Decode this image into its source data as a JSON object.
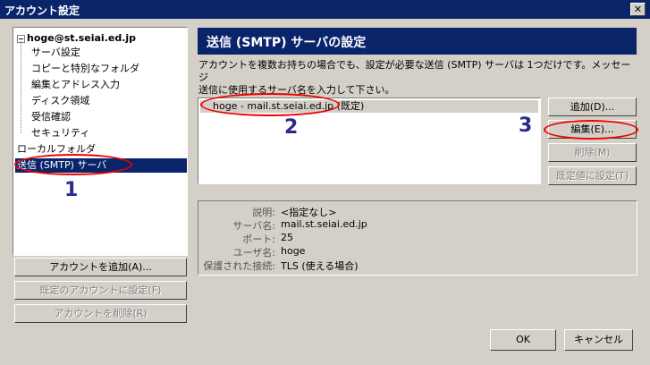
{
  "window": {
    "title": "アカウント設定",
    "close": "✕"
  },
  "tree": {
    "account": "hoge@st.seiai.ed.jp",
    "children": [
      "サーバ設定",
      "コピーと特別なフォルダ",
      "編集とアドレス入力",
      "ディスク領域",
      "受信確認",
      "セキュリティ"
    ],
    "local_folders": "ローカルフォルダ",
    "smtp": "送信 (SMTP) サーバ"
  },
  "left_buttons": {
    "add_account": "アカウントを追加(A)...",
    "set_default": "既定のアカウントに設定(F)",
    "delete_account": "アカウントを削除(R)"
  },
  "panel": {
    "title": "送信 (SMTP) サーバの設定",
    "description_line1": "アカウントを複数お持ちの場合でも、設定が必要な送信 (SMTP) サーバは 1つだけです。メッセージ",
    "description_line2": "送信に使用するサーバ名を入力して下さい。",
    "server_entry": "hoge - mail.st.seiai.ed.jp (既定)"
  },
  "right_buttons": {
    "add": "追加(D)...",
    "edit": "編集(E)...",
    "delete": "削除(M)",
    "set_default": "既定値に設定(T)"
  },
  "details": {
    "description_label": "説明:",
    "description_value": "<指定なし>",
    "server_label": "サーバ名:",
    "server_value": "mail.st.seiai.ed.jp",
    "port_label": "ポート:",
    "port_value": "25",
    "user_label": "ユーザ名:",
    "user_value": "hoge",
    "security_label": "保護された接続:",
    "security_value": "TLS (使える場合)"
  },
  "footer": {
    "ok": "OK",
    "cancel": "キャンセル"
  },
  "annotations": {
    "one": "1",
    "two": "2",
    "three": "3"
  },
  "colors": {
    "titlebar": "#0a246a",
    "face": "#d4d0c8",
    "annotation_red": "#ee0000",
    "annotation_number": "#2a2a8a"
  }
}
